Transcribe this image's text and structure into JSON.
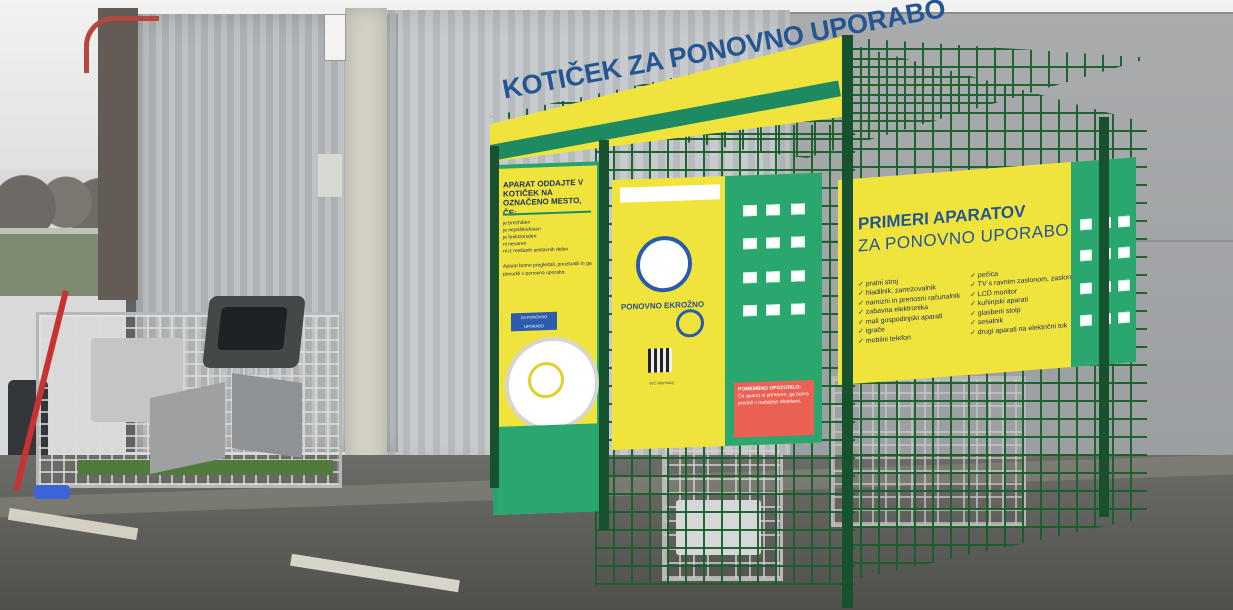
{
  "signs": {
    "top": "KOTIČEK ZA PONOVNO UPORABO",
    "left_title": "APARAT ODDAJTE V KOTIČEK NA OZNAČENO MESTO, ČE:",
    "left_rules": [
      "je brezhiben",
      "je nepoškodovan",
      "je funkcionalen",
      "ni nevaren",
      "ni iz mešanih sestavnih delov"
    ],
    "left_note": "Aparat bomo pregledali, preizkusili in ga ponudili v ponovno uporabo.",
    "left_badge": "ZA PONOVNO UPORABO",
    "center_logo": "PONOVNO EKROŽNO",
    "center_qr_text": "Več informacij",
    "center_warning_title": "POMEMBNO OPOZORILO:",
    "center_warning_text": "Če aparat ni primeren, ga bomo predali v nadaljnjo obdelavo.",
    "right_title": "PRIMERI APARATOV",
    "right_subtitle": "ZA PONOVNO UPORABO",
    "right_col1": [
      "✓ pralni stroj",
      "✓ hladilnik, zamrzovalnik",
      "✓ namizni in prenosni računalnik",
      "✓ zabavna elektronika",
      "✓ mali gospodinjski aparati",
      "✓ igrače",
      "✓ mobilni telefon"
    ],
    "right_col2": [
      "✓ pečica",
      "✓ TV s ravnim zaslonom, zaslonom",
      "✓ LCD monitor",
      "✓ kuhinjski aparati",
      "✓ glasbeni stolp",
      "✓ sesalnik",
      "✓ drugi aparati na električni tok"
    ]
  },
  "colors": {
    "sign_yellow": "#f0e33c",
    "sign_green": "#2aa76f",
    "text_blue": "#245694",
    "fence_green": "#16522e"
  },
  "icons": [
    "washer-icon",
    "fridge-icon",
    "computer-icon",
    "tv-icon",
    "appliance-icon",
    "toy-icon"
  ]
}
